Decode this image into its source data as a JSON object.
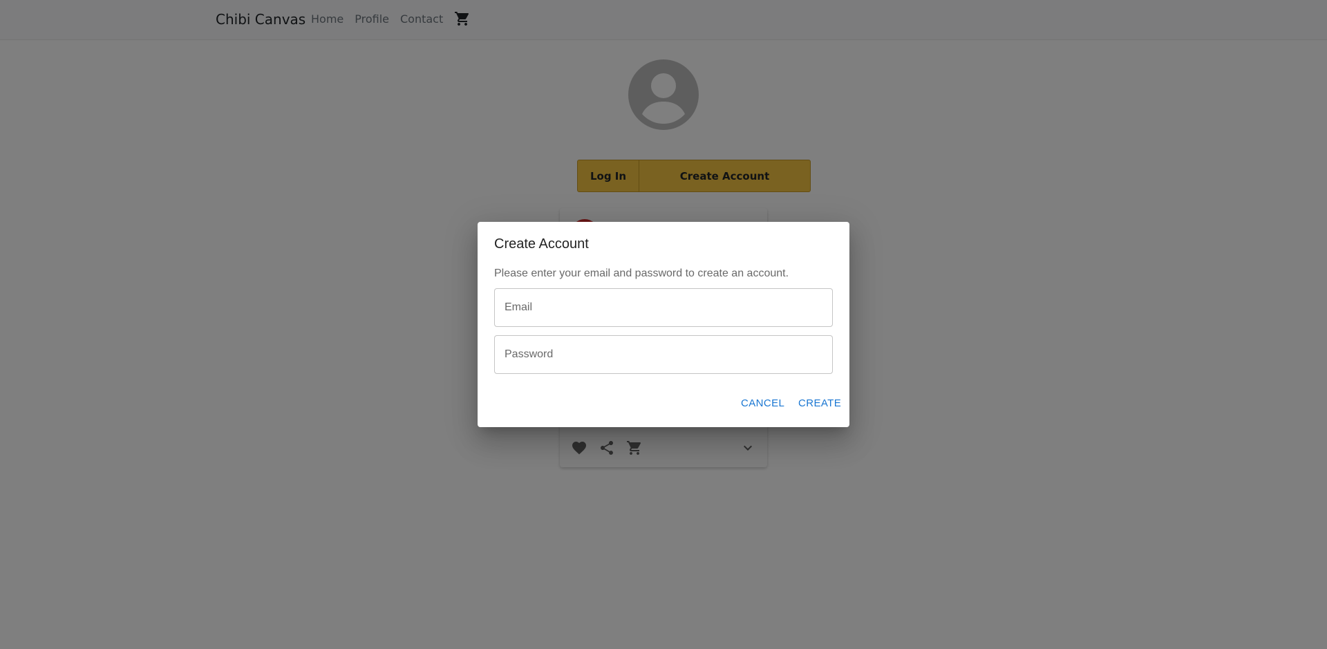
{
  "navbar": {
    "brand": "Chibi Canvas",
    "links": [
      "Home",
      "Profile",
      "Contact"
    ],
    "cart_icon": "cart-icon"
  },
  "profile": {
    "avatar_icon": "account-circle-icon",
    "login_label": "Log In",
    "create_account_label": "Create Account"
  },
  "card": {
    "actions": [
      "heart-icon",
      "share-icon",
      "cart-icon",
      "chevron-down-icon"
    ]
  },
  "dialog": {
    "title": "Create Account",
    "description": "Please enter your email and password to create an account.",
    "email_placeholder": "Email",
    "password_placeholder": "Password",
    "cancel_label": "CANCEL",
    "create_label": "CREATE"
  },
  "colors": {
    "accent_button": "#f5c542",
    "dialog_action": "#1976d2",
    "backdrop": "rgba(0,0,0,0.5)"
  }
}
